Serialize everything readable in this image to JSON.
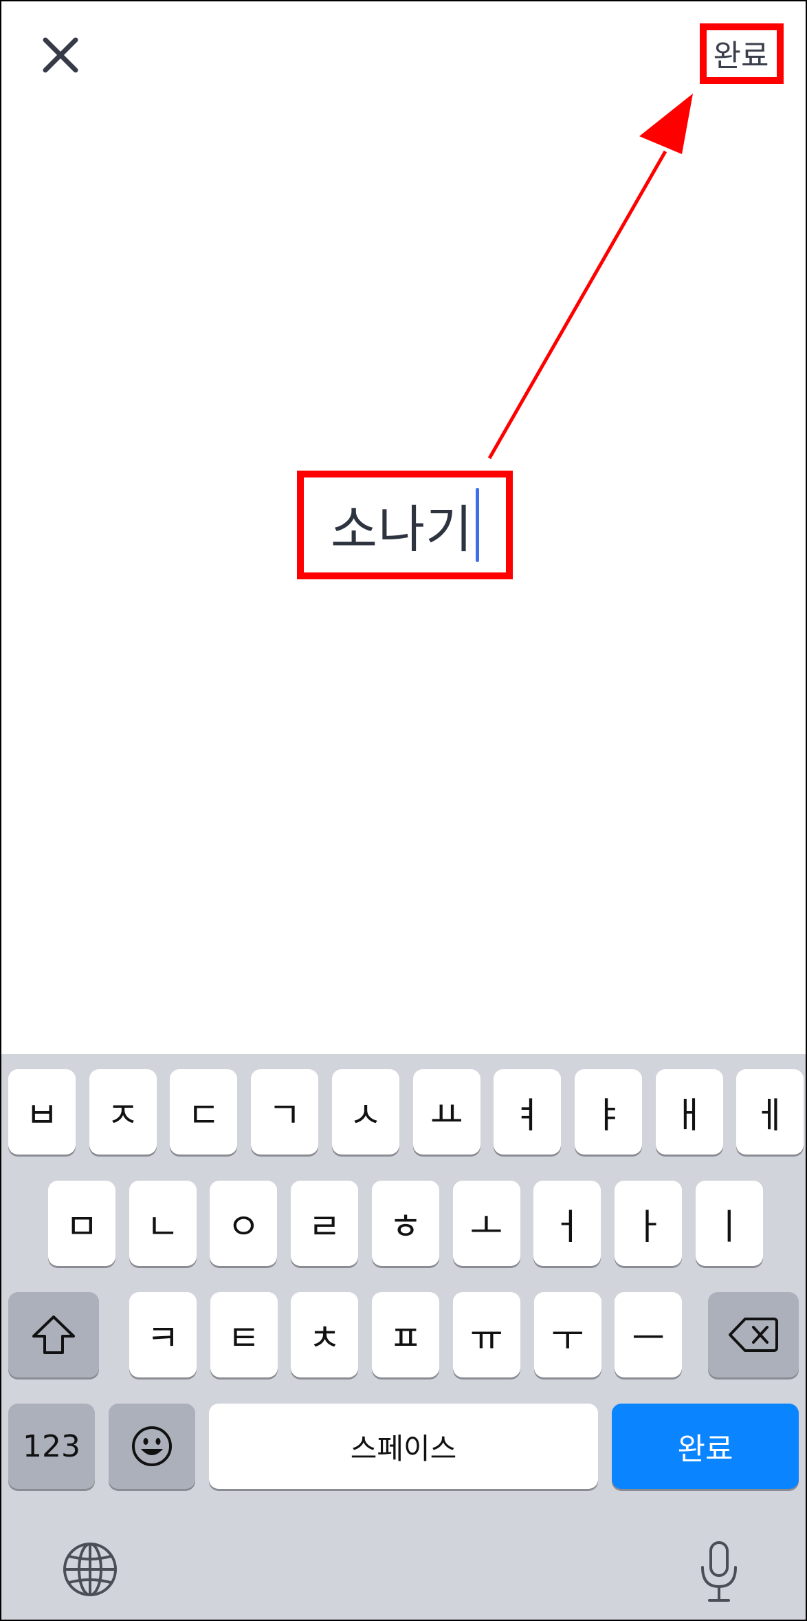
{
  "header": {
    "close_icon": "close-icon",
    "done_label": "완료"
  },
  "editor": {
    "text": "소나기"
  },
  "keyboard": {
    "row1": [
      "ㅂ",
      "ㅈ",
      "ㄷ",
      "ㄱ",
      "ㅅ",
      "ㅛ",
      "ㅕ",
      "ㅑ",
      "ㅐ",
      "ㅔ"
    ],
    "row2": [
      "ㅁ",
      "ㄴ",
      "ㅇ",
      "ㄹ",
      "ㅎ",
      "ㅗ",
      "ㅓ",
      "ㅏ",
      "ㅣ"
    ],
    "row3": [
      "ㅋ",
      "ㅌ",
      "ㅊ",
      "ㅍ",
      "ㅠ",
      "ㅜ",
      "ㅡ"
    ],
    "numbers_label": "123",
    "space_label": "스페이스",
    "return_label": "완료",
    "shift_icon": "shift-icon",
    "backspace_icon": "backspace-icon",
    "emoji_icon": "emoji-icon",
    "globe_icon": "globe-icon",
    "mic_icon": "microphone-icon"
  },
  "annotation_color": "#ff0000",
  "accent_color": "#0b84ff"
}
